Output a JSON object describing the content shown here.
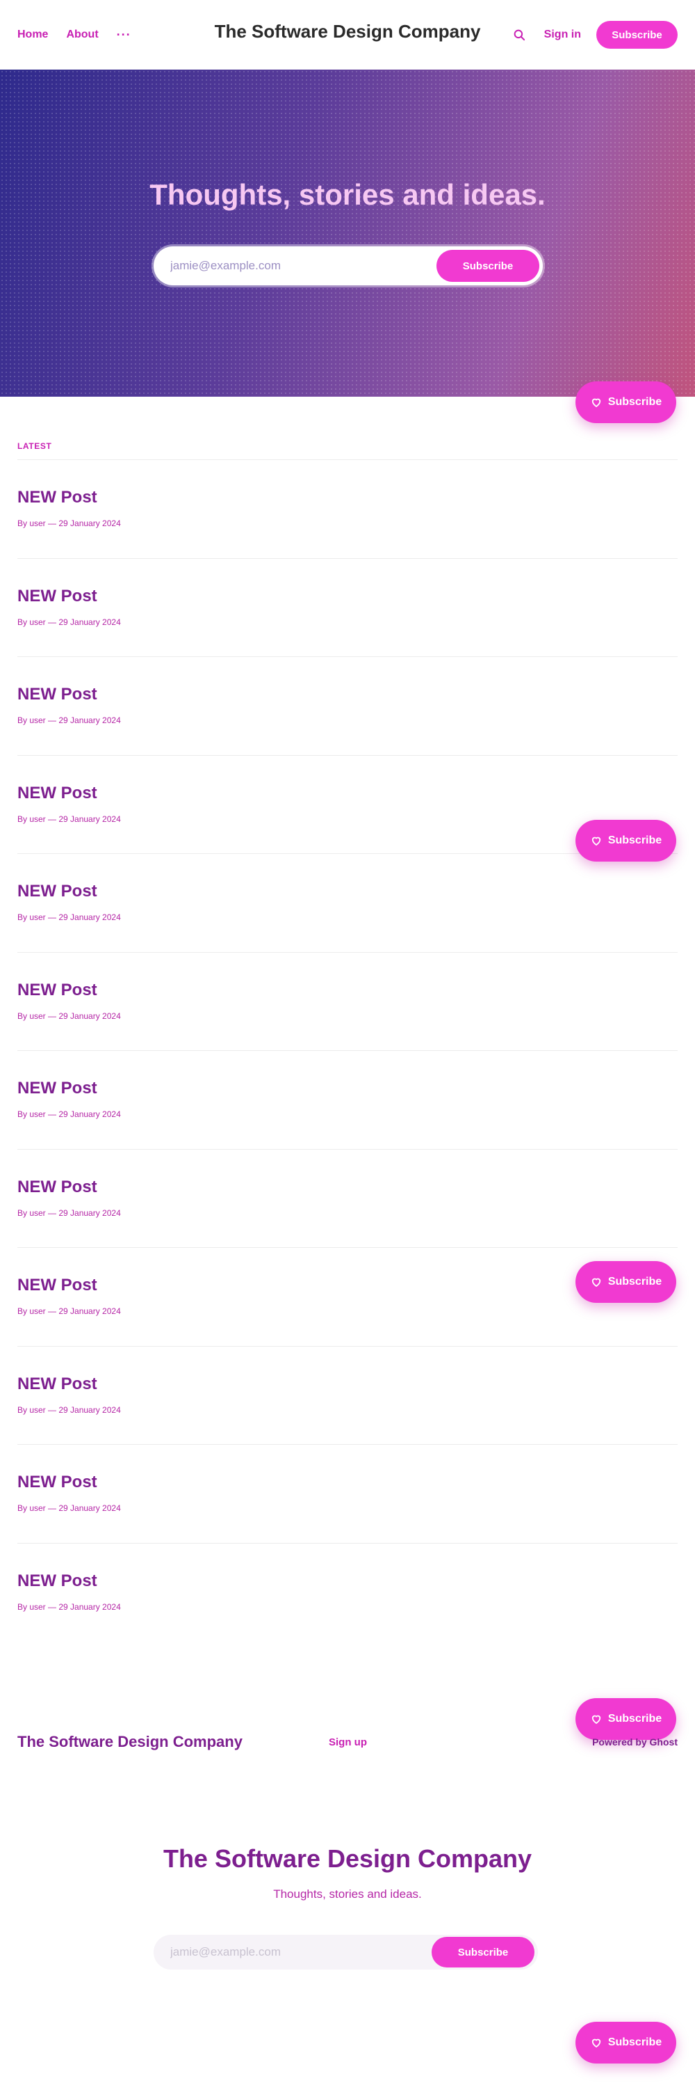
{
  "header": {
    "nav": [
      {
        "label": "Home"
      },
      {
        "label": "About"
      }
    ],
    "more_label": "···",
    "site_title": "The Software Design Company",
    "search_icon": "search-icon",
    "signin_label": "Sign in",
    "subscribe_label": "Subscribe"
  },
  "hero": {
    "title": "Thoughts, stories and ideas.",
    "email_placeholder": "jamie@example.com",
    "submit_label": "Subscribe"
  },
  "feed": {
    "section_label": "LATEST",
    "posts": [
      {
        "title": "NEW Post",
        "meta": "By user — 29 January 2024"
      },
      {
        "title": "NEW Post",
        "meta": "By user — 29 January 2024"
      },
      {
        "title": "NEW Post",
        "meta": "By user — 29 January 2024"
      },
      {
        "title": "NEW Post",
        "meta": "By user — 29 January 2024"
      },
      {
        "title": "NEW Post",
        "meta": "By user — 29 January 2024"
      },
      {
        "title": "NEW Post",
        "meta": "By user — 29 January 2024"
      },
      {
        "title": "NEW Post",
        "meta": "By user — 29 January 2024"
      },
      {
        "title": "NEW Post",
        "meta": "By user — 29 January 2024"
      },
      {
        "title": "NEW Post",
        "meta": "By user — 29 January 2024"
      },
      {
        "title": "NEW Post",
        "meta": "By user — 29 January 2024"
      },
      {
        "title": "NEW Post",
        "meta": "By user — 29 January 2024"
      },
      {
        "title": "NEW Post",
        "meta": "By user — 29 January 2024"
      }
    ]
  },
  "portal": {
    "label": "Subscribe",
    "icon": "heart-icon"
  },
  "footer": {
    "title": "The Software Design Company",
    "signup_label": "Sign up",
    "powered_label": "Powered by Ghost"
  },
  "cta": {
    "title": "The Software Design Company",
    "subtitle": "Thoughts, stories and ideas.",
    "email_placeholder": "jamie@example.com",
    "submit_label": "Subscribe"
  },
  "colors": {
    "accent": "#f13ad1",
    "link": "#c81fb3",
    "post_title": "#7d1f8f"
  }
}
